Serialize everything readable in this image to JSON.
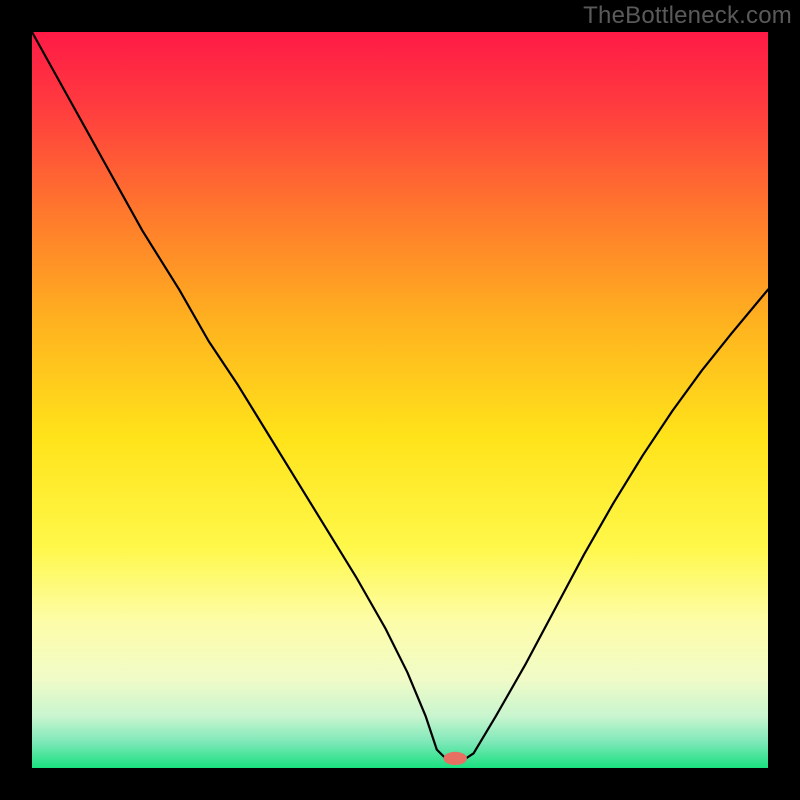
{
  "watermark": "TheBottleneck.com",
  "chart_data": {
    "type": "line",
    "title": "",
    "xlabel": "",
    "ylabel": "",
    "xlim": [
      0,
      100
    ],
    "ylim": [
      0,
      100
    ],
    "grid": false,
    "legend": false,
    "background_gradient": {
      "stops": [
        {
          "offset": 0.0,
          "color": "#ff1a46"
        },
        {
          "offset": 0.1,
          "color": "#ff3b3f"
        },
        {
          "offset": 0.25,
          "color": "#ff7a2c"
        },
        {
          "offset": 0.4,
          "color": "#ffb41f"
        },
        {
          "offset": 0.55,
          "color": "#ffe31a"
        },
        {
          "offset": 0.7,
          "color": "#fff84a"
        },
        {
          "offset": 0.8,
          "color": "#fdfda8"
        },
        {
          "offset": 0.88,
          "color": "#f0fbc8"
        },
        {
          "offset": 0.93,
          "color": "#c8f5cf"
        },
        {
          "offset": 0.965,
          "color": "#7de8b8"
        },
        {
          "offset": 1.0,
          "color": "#19e07f"
        }
      ]
    },
    "series": [
      {
        "name": "bottleneck-curve",
        "x": [
          0.0,
          5.0,
          10.0,
          15.0,
          20.0,
          24.0,
          28.0,
          32.0,
          36.0,
          40.0,
          44.0,
          48.0,
          51.0,
          53.5,
          55.0,
          56.5,
          58.5,
          60.0,
          63.0,
          67.0,
          71.0,
          75.0,
          79.0,
          83.0,
          87.0,
          91.0,
          95.0,
          100.0
        ],
        "y": [
          100.0,
          91.0,
          82.0,
          73.0,
          65.0,
          58.0,
          52.0,
          45.5,
          39.0,
          32.5,
          26.0,
          19.0,
          13.0,
          7.0,
          2.5,
          1.0,
          1.0,
          2.0,
          7.0,
          14.0,
          21.5,
          29.0,
          36.0,
          42.5,
          48.5,
          54.0,
          59.0,
          65.0
        ]
      }
    ],
    "marker": {
      "x": 57.5,
      "y": 1.3,
      "color": "#e77063",
      "rx": 1.6,
      "ry": 0.9
    }
  }
}
